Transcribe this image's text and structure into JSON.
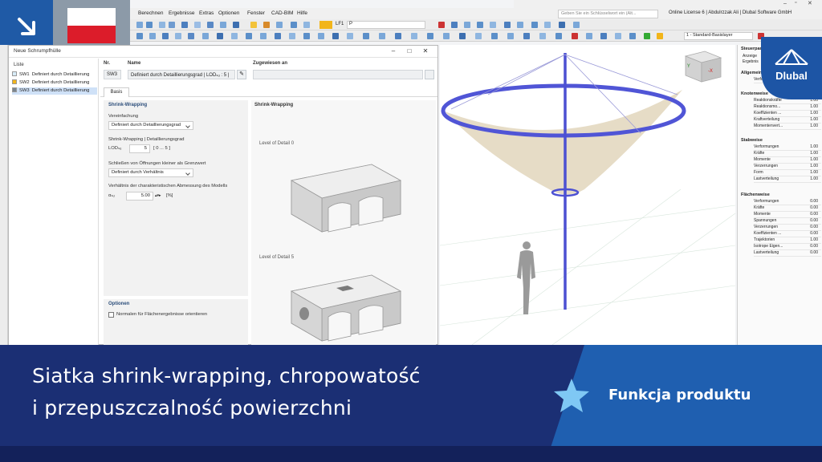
{
  "app": {
    "menu": [
      "Berechnen",
      "Ergebnisse",
      "Extras",
      "Optionen",
      "Fenster",
      "CAD-BIM",
      "Hilfe"
    ],
    "search_placeholder": "Geben Sie ein Schlüsselwort ein (Alt...",
    "license": "Online License 6 | Abdulrzzak Ali | Dlubal Software GmbH",
    "toolbar_lf": "LF1",
    "toolbar_lc": "P",
    "toolbar_layer": "1 - Standard-Basislayer"
  },
  "dialog": {
    "title": "Neue Schrumpfhülle",
    "list_header": "Liste",
    "items": [
      {
        "id": "SW1",
        "label": "Definiert durch Detaillierung",
        "color": "#d8ecf8"
      },
      {
        "id": "SW2",
        "label": "Definiert durch Detaillierung",
        "color": "#f2b51a"
      },
      {
        "id": "SW3",
        "label": "Definiert durch Detaillierung",
        "color": "#7a8590"
      }
    ],
    "nr_label": "Nr.",
    "nr_value": "SW3",
    "name_label": "Name",
    "name_value": "Definiert durch Detaillierungsgrad | LODₛᵤ : 5 |",
    "assigned_label": "Zugewiesen an",
    "tab_basis": "Basis",
    "section_shrink": "Shrink-Wrapping",
    "simplification_label": "Vereinfachung",
    "simplification_value": "Definiert durch Detaillierungsgrad",
    "lod_section_label": "Shrink-Wrapping | Detaillierungsgrad",
    "lod_label": "LODₛᵤ",
    "lod_value": "5",
    "lod_range": "[ 0 ... 5 ]",
    "closing_label": "Schließen von Öffnungen kleiner als Grenzwert",
    "closing_value": "Definiert durch Verhältnis",
    "ratio_label": "Verhältnis der charakteristischen Abmessung des Modells",
    "ratio_symbol": "αₛᵤ",
    "ratio_value": "5.00",
    "ratio_unit": "[%]",
    "options_header": "Optionen",
    "options_checkbox": "Normalen für Flächenergebnisse orientieren",
    "image_header": "Shrink-Wrapping",
    "lod0_caption": "Level of Detail 0",
    "lod5_caption": "Level of Detail 5"
  },
  "panel": {
    "title": "Steuerpanel",
    "sub1": "Anzeige",
    "sub2": "Ergebnis",
    "group_general": "Allgemein",
    "general_item": "Verformungen",
    "group_nodal": "Knotenweise",
    "nodal": [
      {
        "label": "Reaktionskräfte",
        "value": "1.00"
      },
      {
        "label": "Reaktionsmo...",
        "value": "1.00"
      },
      {
        "label": "Koeffizienten ...",
        "value": "1.00"
      },
      {
        "label": "Kraftverteilung",
        "value": "1.00"
      },
      {
        "label": "Momentenvert...",
        "value": "1.00"
      }
    ],
    "group_member": "Stabweise",
    "member": [
      {
        "label": "Verformungen",
        "value": "1.00"
      },
      {
        "label": "Kräfte",
        "value": "1.00"
      },
      {
        "label": "Momente",
        "value": "1.00"
      },
      {
        "label": "Verzerrungen",
        "value": "1.00"
      },
      {
        "label": "Form",
        "value": "1.00"
      },
      {
        "label": "Lastverteilung",
        "value": "1.00"
      }
    ],
    "group_surface": "Flächenweise",
    "surface": [
      {
        "label": "Verformungen",
        "value": "0.00"
      },
      {
        "label": "Kräfte",
        "value": "0.00"
      },
      {
        "label": "Momente",
        "value": "0.00"
      },
      {
        "label": "Spannungen",
        "value": "0.00"
      },
      {
        "label": "Verzerrungen",
        "value": "0.00"
      },
      {
        "label": "Koeffizienten ...",
        "value": "0.00"
      },
      {
        "label": "Trajektorien",
        "value": "1.00"
      },
      {
        "label": "Isotrope Eigen...",
        "value": "0.00"
      },
      {
        "label": "Lastverteilung",
        "value": "0.00"
      }
    ]
  },
  "banner": {
    "line1": "Siatka shrink-wrapping, chropowatość",
    "line2": "i przepuszczalność powierzchni",
    "feature": "Funkcja produktu"
  },
  "logo": {
    "text": "Dlubal"
  },
  "colors": {
    "banner": "#1b2f74",
    "accent": "#1f5fb0",
    "brand": "#1d55a5"
  }
}
